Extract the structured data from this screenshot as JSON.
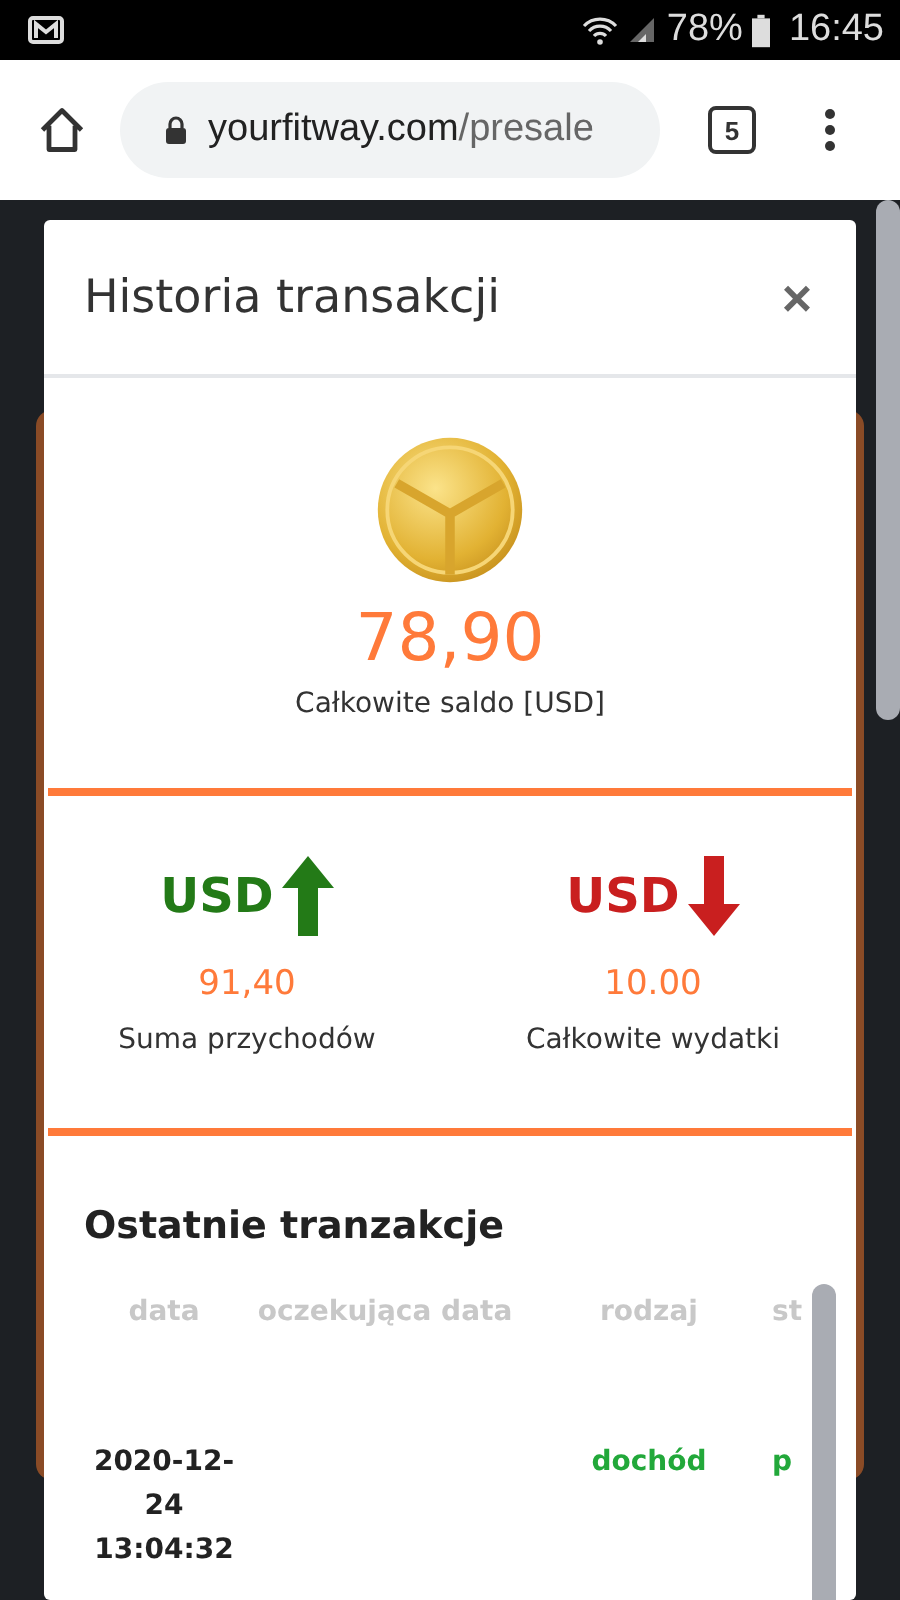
{
  "status_bar": {
    "battery": "78%",
    "time": "16:45"
  },
  "browser": {
    "url_host": "yourfitway.com",
    "url_path": "/presale",
    "tab_count": "5"
  },
  "modal": {
    "title": "Historia transakcji",
    "close": "×",
    "balance": {
      "amount": "78,90",
      "label": "Całkowite saldo [USD]"
    },
    "stats": [
      {
        "kind": "income",
        "currency": "USD",
        "amount": "91,40",
        "label": "Suma przychodów"
      },
      {
        "kind": "expense",
        "currency": "USD",
        "amount": "10.00",
        "label": "Całkowite wydatki"
      }
    ],
    "recent": {
      "title": "Ostatnie tranzakcje",
      "columns": [
        "data",
        "oczekująca data",
        "rodzaj",
        "st"
      ],
      "rows": [
        [
          "2020-12-24 13:04:32",
          "",
          "dochód",
          "p"
        ]
      ]
    }
  }
}
